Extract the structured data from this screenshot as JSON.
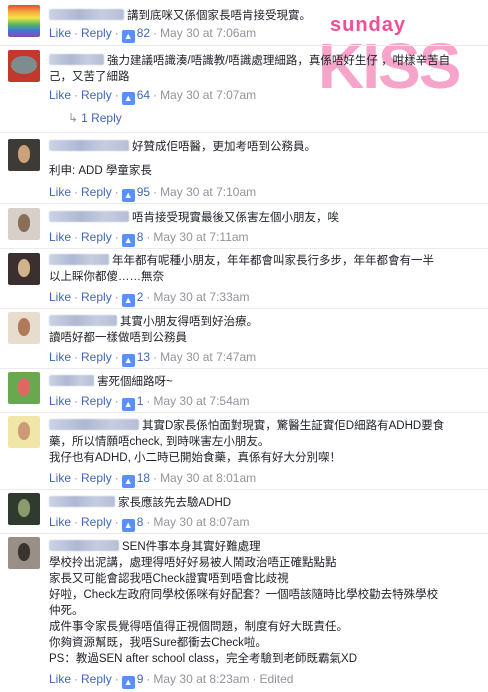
{
  "brand": {
    "logo_top": "sunday",
    "logo_bottom": "KISS",
    "accent": "#f04f97"
  },
  "labels": {
    "like": "Like",
    "reply": "Reply",
    "sep": "·",
    "like_icon": "👍"
  },
  "comments": [
    {
      "lines": [
        "講到底咪又係個家長唔肯接受現實。"
      ],
      "likes": "82",
      "time": "May 30 at 7:06am"
    },
    {
      "lines": [
        "強力建議唔識湊/唔識教/唔識處理細路，真係唔好生仔 ，咁樣辛苦自",
        "己，又苦了細路"
      ],
      "likes": "64",
      "time": "May 30 at 7:07am",
      "reply_count": "1 Reply"
    },
    {
      "lines": [
        "好贊成佢唔醫，更加考唔到公務員。",
        "",
        "利申: ADD 學童家長"
      ],
      "likes": "95",
      "time": "May 30 at 7:10am"
    },
    {
      "lines": [
        "唔肯接受現實最後又係害左個小朋友，唉"
      ],
      "likes": "8",
      "time": "May 30 at 7:11am"
    },
    {
      "lines": [
        "年年都有呢種小朋友，年年都會叫家長行多步，年年都會有一半",
        "以上睬你都傻……無奈"
      ],
      "likes": "2",
      "time": "May 30 at 7:33am"
    },
    {
      "lines": [
        "其實小朋友得唔到好治療。",
        "讀唔好都一樣做唔到公務員"
      ],
      "likes": "13",
      "time": "May 30 at 7:47am"
    },
    {
      "lines": [
        "害死個細路呀~"
      ],
      "likes": "1",
      "time": "May 30 at 7:54am"
    },
    {
      "lines": [
        "其實D家長係怕面對現實，驚醫生証實佢D細路有ADHD要食",
        "藥，所以情願唔check, 到時咪害左小朋友。",
        "我仔也有ADHD, 小二時已開始食藥，真係有好大分別㗎！"
      ],
      "likes": "18",
      "time": "May 30 at 8:01am"
    },
    {
      "lines": [
        "家長應該先去驗ADHD"
      ],
      "likes": "8",
      "time": "May 30 at 8:07am"
    },
    {
      "lines": [
        "SEN件事本身其實好難處理",
        "學校拎出泥講，處理得唔好好易被人鬧政治唔正確點點點",
        "家長又可能會認我唔Check證實唔到唔會比歧視",
        "好啦，Check左政府同學校係咪有好配套？一個唔該隨時比學校勸去特殊學校",
        "仲死。",
        "成件事令家長覺得唔值得正視個問題，制度有好大既責任。",
        "你夠資源幫既，我唔Sure都衝去Check啦。",
        "PS：教過SEN after school class，完全考驗到老師既霸氣XD"
      ],
      "likes": "9",
      "time": "May 30 at 8:23am",
      "edited": "Edited"
    }
  ]
}
